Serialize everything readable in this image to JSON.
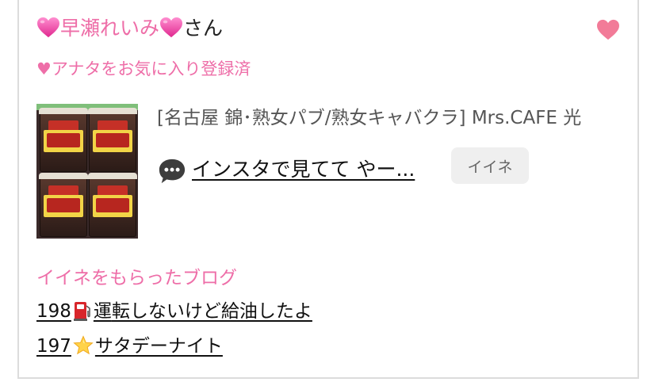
{
  "profile": {
    "name": "早瀬れいみ",
    "suffix": "さん",
    "favorite_status": "♥アナタをお気に入り登録済"
  },
  "post": {
    "shop": "[名古屋 錦･熟女パブ/熟女キャバクラ]  Mrs.CAFE 光",
    "comment": "インスタで見てて やー...",
    "iine_label": "イイネ"
  },
  "liked_blogs": {
    "title": "イイネをもらったブログ",
    "items": [
      {
        "number": "198",
        "text_a": "運",
        "text_b": "転しないけど給油したよ"
      },
      {
        "number": "197",
        "text": "サタデーナイト"
      }
    ]
  },
  "colors": {
    "accent_pink": "#ee6ea8",
    "heart_pink": "#f27b98",
    "button_bg": "#efefef"
  },
  "icons": [
    "heart-icon",
    "speech-bubble-icon",
    "fuel-pump-icon",
    "star-icon"
  ]
}
